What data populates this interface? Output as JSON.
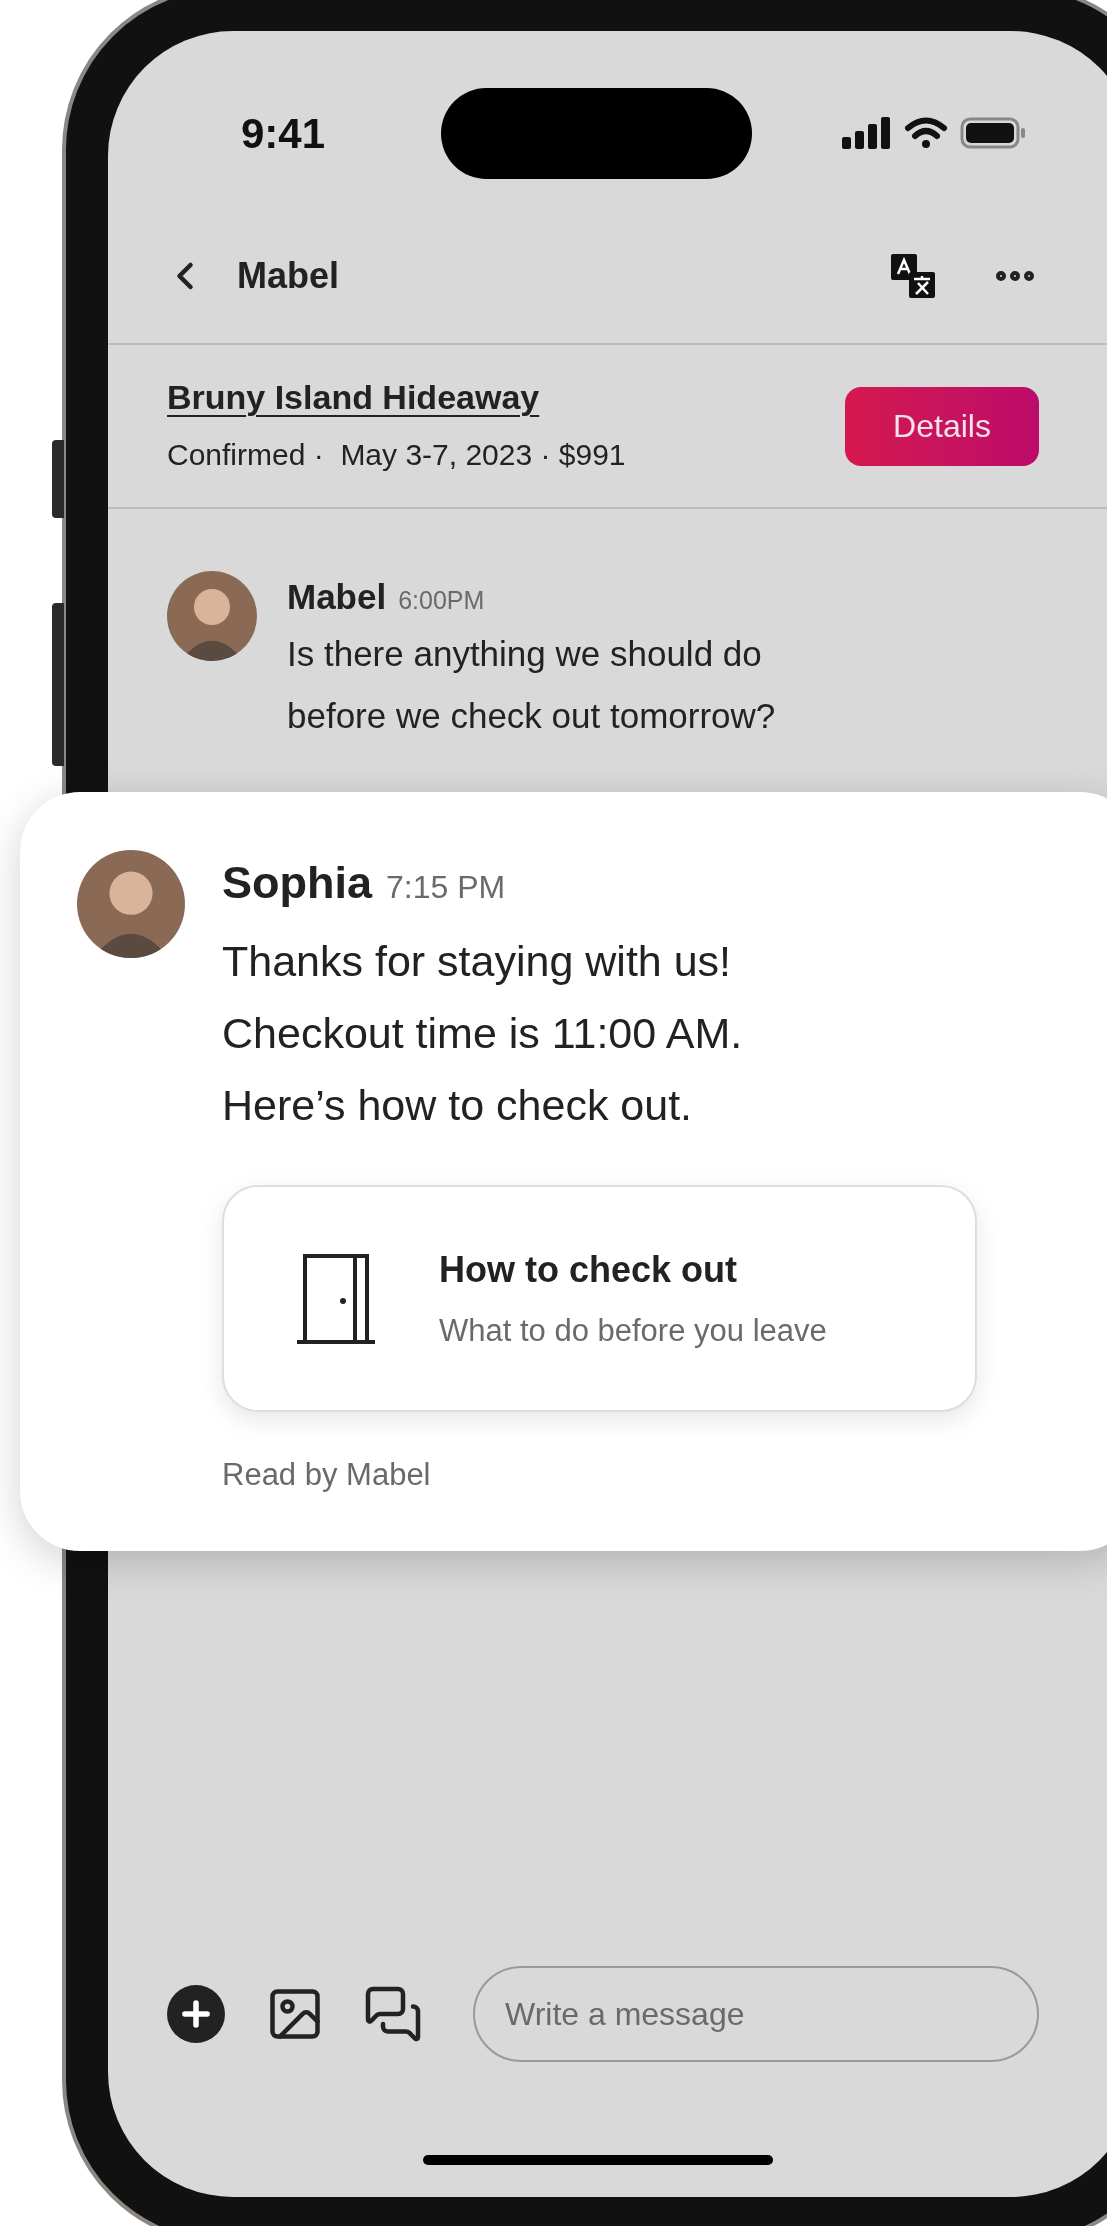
{
  "status_bar": {
    "time": "9:41"
  },
  "header": {
    "title": "Mabel"
  },
  "reservation": {
    "title": "Bruny Island Hideaway",
    "subtitle": "Confirmed ·  May 3-7, 2023 · $991",
    "button": "Details"
  },
  "messages": [
    {
      "kind": "plain",
      "sender": "Mabel",
      "time": "6:00PM",
      "lines": [
        "Is there anything we should do before we check out tomorrow?"
      ]
    },
    {
      "kind": "card",
      "sender": "Sophia",
      "time": "7:15 PM",
      "lines": [
        "Thanks for staying with us!",
        "Checkout time is 11:00 AM.",
        "Here’s how to check out."
      ],
      "attachment": {
        "title": "How to check out",
        "subtitle": "What to do before you leave"
      },
      "receipt": "Read by Mabel"
    }
  ],
  "composer": {
    "placeholder": "Write a message"
  }
}
